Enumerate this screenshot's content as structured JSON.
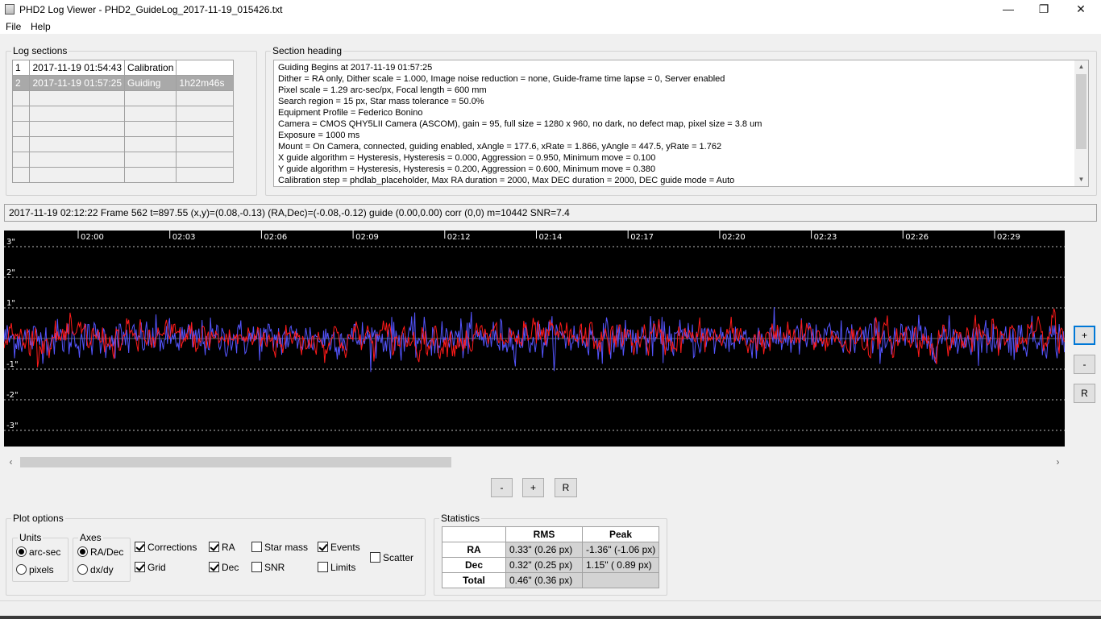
{
  "window": {
    "title": "PHD2 Log Viewer - PHD2_GuideLog_2017-11-19_015426.txt",
    "minimize_glyph": "—",
    "maximize_glyph": "❐",
    "close_glyph": "✕"
  },
  "menu": [
    "File",
    "Help"
  ],
  "log_sections": {
    "label": "Log sections",
    "rows": [
      {
        "num": "1",
        "time": "2017-11-19 01:54:43",
        "type": "Calibration",
        "duration": ""
      },
      {
        "num": "2",
        "time": "2017-11-19 01:57:25",
        "type": "Guiding",
        "duration": "1h22m46s"
      }
    ],
    "selected_row": 1,
    "empty_rows": 6
  },
  "section_heading": {
    "label": "Section heading",
    "lines": [
      "Guiding Begins at 2017-11-19 01:57:25",
      "Dither = RA only, Dither scale = 1.000, Image noise reduction = none, Guide-frame time lapse = 0, Server enabled",
      "Pixel scale = 1.29 arc-sec/px, Focal length = 600 mm",
      "Search region = 15 px, Star mass tolerance = 50.0%",
      "Equipment Profile = Federico Bonino",
      "Camera = CMOS QHY5LII Camera (ASCOM), gain = 95, full size = 1280 x 960, no dark, no defect map, pixel size = 3.8 um",
      "Exposure = 1000 ms",
      "Mount = On Camera,  connected, guiding enabled, xAngle = 177.6, xRate = 1.866, yAngle = 447.5, yRate = 1.762",
      "X guide algorithm = Hysteresis, Hysteresis = 0.000, Aggression = 0.950, Minimum move = 0.100",
      "Y guide algorithm = Hysteresis, Hysteresis = 0.200, Aggression = 0.600, Minimum move = 0.380",
      "Calibration step = phdlab_placeholder, Max RA duration = 2000, Max DEC duration = 2000, DEC guide mode = Auto"
    ],
    "scroll_up": "▲",
    "scroll_down": "▼"
  },
  "status_line": "2017-11-19 02:12:22 Frame 562 t=897.55 (x,y)=(0.08,-0.13) (RA,Dec)=(-0.08,-0.12) guide (0.00,0.00) corr (0,0) m=10442 SNR=7.4",
  "chart_data": {
    "type": "line",
    "x_tick_labels": [
      "02:00",
      "02:03",
      "02:06",
      "02:09",
      "02:12",
      "02:14",
      "02:17",
      "02:20",
      "02:23",
      "02:26",
      "02:29"
    ],
    "y_tick_labels": [
      "3\"",
      "2\"",
      "1\"",
      "-1\"",
      "-2\"",
      "-3\""
    ],
    "y_tick_values": [
      3,
      2,
      1,
      -1,
      -2,
      -3
    ],
    "ylim": [
      -3.3,
      3.7
    ],
    "grid": true,
    "background": "#000000",
    "series": [
      {
        "color": "#5555ff",
        "rms": 0.33,
        "peak": 1.36
      },
      {
        "color": "#ff1a1a",
        "rms": 0.32,
        "peak": 1.15
      }
    ]
  },
  "scrollbar": {
    "left": "‹",
    "right": "›"
  },
  "zoom_buttons": {
    "minus": "-",
    "plus": "+",
    "reset": "R"
  },
  "side_buttons": {
    "plus": "+",
    "minus": "-",
    "reset": "R"
  },
  "plot_options": {
    "label": "Plot options",
    "units": {
      "label": "Units",
      "arcsec": "arc-sec",
      "pixels": "pixels"
    },
    "axes": {
      "label": "Axes",
      "radec": "RA/Dec",
      "dxdy": "dx/dy"
    },
    "checks": {
      "corrections": "Corrections",
      "grid": "Grid",
      "ra": "RA",
      "dec": "Dec",
      "star_mass": "Star mass",
      "snr": "SNR",
      "events": "Events",
      "limits": "Limits",
      "scatter": "Scatter"
    }
  },
  "statistics": {
    "label": "Statistics",
    "col_rms": "RMS",
    "col_peak": "Peak",
    "rows": [
      {
        "name": "RA",
        "rms": "0.33\" (0.26 px)",
        "peak": "-1.36\" (-1.06 px)"
      },
      {
        "name": "Dec",
        "rms": "0.32\" (0.25 px)",
        "peak": "1.15\" ( 0.89 px)"
      },
      {
        "name": "Total",
        "rms": "0.46\" (0.36 px)",
        "peak": ""
      }
    ]
  }
}
